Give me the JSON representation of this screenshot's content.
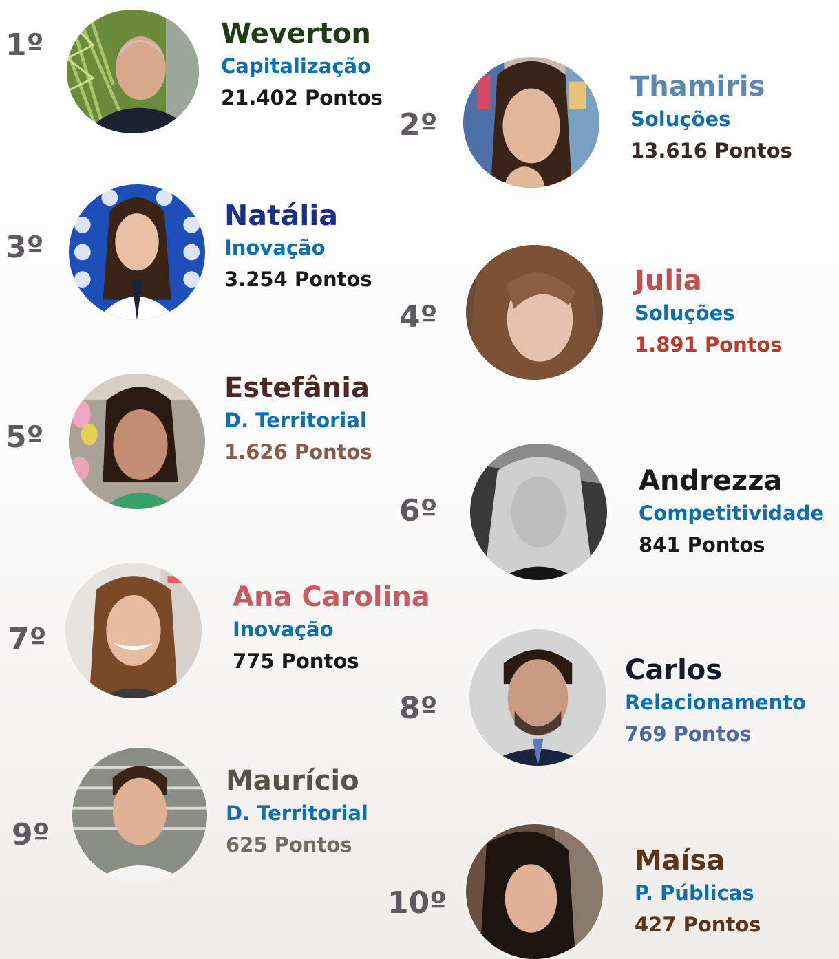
{
  "ranking": [
    {
      "rank": "1º",
      "name": "Weverton",
      "dept": "Capitalização",
      "points": "21.402 Pontos",
      "name_color": "#1f3d12",
      "dept_color": "#0e6fb0",
      "points_color": "#1a1a1a",
      "photo": "man-palm-leaves"
    },
    {
      "rank": "2º",
      "name": "Thamiris",
      "dept": "Soluções",
      "points": "13.616 Pontos",
      "name_color": "#5b87b0",
      "dept_color": "#0e6fb0",
      "points_color": "#3a2a26",
      "photo": "woman-colorful-wall"
    },
    {
      "rank": "3º",
      "name": "Natália",
      "dept": "Inovação",
      "points": "3.254 Pontos",
      "name_color": "#1a2e8c",
      "dept_color": "#0e6fb0",
      "points_color": "#1a1a1a",
      "photo": "woman-blue-pattern"
    },
    {
      "rank": "4º",
      "name": "Julia",
      "dept": "Soluções",
      "points": "1.891 Pontos",
      "name_color": "#c0504d",
      "dept_color": "#0e6fb0",
      "points_color": "#c0392b",
      "photo": "woman-long-hair"
    },
    {
      "rank": "5º",
      "name": "Estefânia",
      "dept": "D. Territorial",
      "points": "1.626 Pontos",
      "name_color": "#4a2a22",
      "dept_color": "#0e6fb0",
      "points_color": "#8a5a48",
      "photo": "woman-balloons"
    },
    {
      "rank": "6º",
      "name": "Andrezza",
      "dept": "Competitividade",
      "points": "841 Pontos",
      "name_color": "#1a1a1a",
      "dept_color": "#0e6fb0",
      "points_color": "#1a1a1a",
      "photo": "woman-black-white"
    },
    {
      "rank": "7º",
      "name": "Ana Carolina",
      "dept": "Inovação",
      "points": "775 Pontos",
      "name_color": "#c85a64",
      "dept_color": "#0e6fb0",
      "points_color": "#1a1a1a",
      "photo": "woman-smiling"
    },
    {
      "rank": "8º",
      "name": "Carlos",
      "dept": "Relacionamento",
      "points": "769 Pontos",
      "name_color": "#141a2a",
      "dept_color": "#0e6fb0",
      "points_color": "#4a6aa0",
      "photo": "man-suit"
    },
    {
      "rank": "9º",
      "name": "Maurício",
      "dept": "D. Territorial",
      "points": "625 Pontos",
      "name_color": "#55524a",
      "dept_color": "#0e6fb0",
      "points_color": "#6e6e62",
      "photo": "man-building"
    },
    {
      "rank": "10º",
      "name": "Maísa",
      "dept": "P. Públicas",
      "points": "427 Pontos",
      "name_color": "#5a3518",
      "dept_color": "#0e6fb0",
      "points_color": "#5a3518",
      "photo": "woman-dark-hair"
    }
  ]
}
